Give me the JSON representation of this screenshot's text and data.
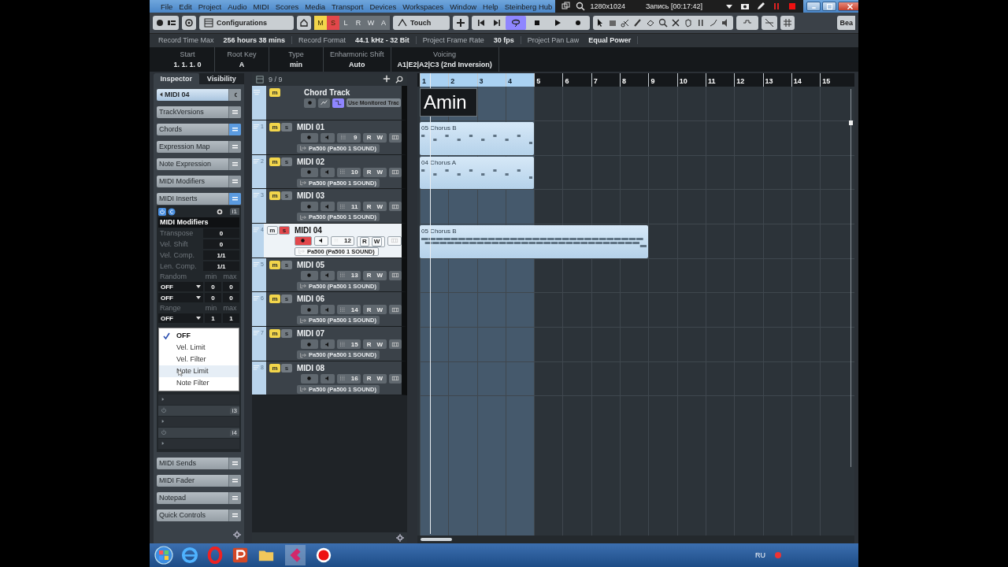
{
  "menu_bar": {
    "items": [
      "File",
      "Edit",
      "Project",
      "Audio",
      "MIDI",
      "Scores",
      "Media",
      "Transport",
      "Devices",
      "Workspaces",
      "Window",
      "Help",
      "Steinberg Hub"
    ]
  },
  "recorder_overlay": {
    "resolution": "1280x1024",
    "status": "Запись [00:17:42]"
  },
  "toolbar": {
    "configurations": "Configurations",
    "modes": [
      {
        "label": "M",
        "on": true,
        "color": "#f2d54b"
      },
      {
        "label": "S",
        "on": true,
        "color": "#e2474b"
      },
      {
        "label": "L",
        "on": false
      },
      {
        "label": "R",
        "on": false
      },
      {
        "label": "W",
        "on": false
      },
      {
        "label": "A",
        "on": false
      }
    ],
    "automation_mode": "Touch",
    "cycle_on": true,
    "cut_label": "Bea"
  },
  "status_line": [
    {
      "label": "Record Time Max",
      "value": "256 hours 38 mins"
    },
    {
      "label": "Record Format",
      "value": "44.1 kHz - 32 Bit"
    },
    {
      "label": "Project Frame Rate",
      "value": "30 fps"
    },
    {
      "label": "Project Pan Law",
      "value": "Equal Power"
    }
  ],
  "chord_info": [
    {
      "label": "Start",
      "value": "1. 1. 1.  0"
    },
    {
      "label": "Root Key",
      "value": "A"
    },
    {
      "label": "Type",
      "value": "min"
    },
    {
      "label": "Enharmonic Shift",
      "value": "Auto"
    },
    {
      "label": "Voicing",
      "value": "A1|E2|A2|C3 (2nd Inversion)"
    }
  ],
  "inspector": {
    "tabs": [
      {
        "label": "Inspector",
        "selected": true
      },
      {
        "label": "Visibility",
        "selected": false
      }
    ],
    "track_name": "MIDI 04",
    "sections_top": [
      {
        "label": "TrackVersions",
        "active": false
      },
      {
        "label": "Chords",
        "active": true
      },
      {
        "label": "Expression Map",
        "active": false
      },
      {
        "label": "Note Expression",
        "active": false
      },
      {
        "label": "MIDI Modifiers",
        "active": false
      },
      {
        "label": "MIDI Inserts",
        "active": true
      }
    ],
    "insert": {
      "slot": "i1",
      "title": "MIDI Modifiers",
      "params": [
        {
          "label": "Transpose",
          "value": "0"
        },
        {
          "label": "Vel. Shift",
          "value": "0"
        },
        {
          "label": "Vel. Comp.",
          "value": "1/1"
        },
        {
          "label": "Len. Comp.",
          "value": "1/1"
        }
      ],
      "groups": [
        {
          "label": "Random",
          "min_label": "min",
          "max_label": "max",
          "rows": [
            {
              "mode": "OFF",
              "min": "0",
              "max": "0"
            },
            {
              "mode": "OFF",
              "min": "0",
              "max": "0"
            }
          ]
        },
        {
          "label": "Range",
          "min_label": "min",
          "max_label": "max",
          "rows": [
            {
              "mode": "OFF",
              "min": "1",
              "max": "1"
            }
          ]
        }
      ]
    },
    "dropdown": {
      "items": [
        {
          "label": "OFF",
          "checked": true,
          "hovered": false
        },
        {
          "label": "Vel. Limit",
          "checked": false,
          "hovered": false
        },
        {
          "label": "Vel. Filter",
          "checked": false,
          "hovered": false
        },
        {
          "label": "Note Limit",
          "checked": false,
          "hovered": true
        },
        {
          "label": "Note Filter",
          "checked": false,
          "hovered": false
        }
      ]
    },
    "empty_slots": [
      "i3",
      "i4"
    ],
    "sections_bottom": [
      {
        "label": "MIDI Sends",
        "active": false
      },
      {
        "label": "MIDI Fader",
        "active": false
      },
      {
        "label": "Notepad",
        "active": false
      },
      {
        "label": "Quick Controls",
        "active": false
      }
    ]
  },
  "track_list": {
    "count": "9 / 9",
    "chord_track": {
      "name": "Chord Track",
      "monitor_label": "Use Monitored Trac",
      "mute_label": "m",
      "muted": true,
      "events": [
        {
          "name": "Amin"
        }
      ]
    },
    "tracks": [
      {
        "number": "1",
        "name": "MIDI 01",
        "mute_label": "m",
        "solo_label": "s",
        "channel": "9",
        "read_label": "R",
        "write_label": "W",
        "output": "Pa500 (Pa500 1 SOUND)",
        "muted": true,
        "solo": false,
        "record": false,
        "selected": false,
        "parts": [
          {
            "name": "05 Chorus B"
          }
        ]
      },
      {
        "number": "2",
        "name": "MIDI 02",
        "mute_label": "m",
        "solo_label": "s",
        "channel": "10",
        "read_label": "R",
        "write_label": "W",
        "output": "Pa500 (Pa500 1 SOUND)",
        "muted": true,
        "solo": false,
        "record": false,
        "selected": false,
        "parts": [
          {
            "name": "04 Chorus A"
          }
        ]
      },
      {
        "number": "3",
        "name": "MIDI 03",
        "mute_label": "m",
        "solo_label": "s",
        "channel": "11",
        "read_label": "R",
        "write_label": "W",
        "output": "Pa500 (Pa500 1 SOUND)",
        "muted": true,
        "solo": false,
        "record": false,
        "selected": false
      },
      {
        "number": "4",
        "name": "MIDI 04",
        "mute_label": "m",
        "solo_label": "s",
        "channel": "12",
        "read_label": "R",
        "write_label": "W",
        "output": "Pa500 (Pa500 1 SOUND)",
        "muted": false,
        "solo": true,
        "record": true,
        "selected": true,
        "parts": [
          {
            "name": "05 Chorus B"
          }
        ]
      },
      {
        "number": "5",
        "name": "MIDI 05",
        "mute_label": "m",
        "solo_label": "s",
        "channel": "13",
        "read_label": "R",
        "write_label": "W",
        "output": "Pa500 (Pa500 1 SOUND)",
        "muted": true,
        "solo": false,
        "record": false,
        "selected": false
      },
      {
        "number": "6",
        "name": "MIDI 06",
        "mute_label": "m",
        "solo_label": "s",
        "channel": "14",
        "read_label": "R",
        "write_label": "W",
        "output": "Pa500 (Pa500 1 SOUND)",
        "muted": true,
        "solo": false,
        "record": false,
        "selected": false
      },
      {
        "number": "7",
        "name": "MIDI 07",
        "mute_label": "m",
        "solo_label": "s",
        "channel": "15",
        "read_label": "R",
        "write_label": "W",
        "output": "Pa500 (Pa500 1 SOUND)",
        "muted": true,
        "solo": false,
        "record": false,
        "selected": false
      },
      {
        "number": "8",
        "name": "MIDI 08",
        "mute_label": "m",
        "solo_label": "s",
        "channel": "16",
        "read_label": "R",
        "write_label": "W",
        "output": "Pa500 (Pa500 1 SOUND)",
        "muted": true,
        "solo": false,
        "record": false,
        "selected": false
      }
    ]
  },
  "arrangement": {
    "bars": [
      "1",
      "2",
      "3",
      "4",
      "5",
      "6",
      "7",
      "8",
      "9",
      "10",
      "11",
      "12",
      "13",
      "14",
      "15"
    ]
  },
  "taskbar": {
    "language": "RU"
  }
}
